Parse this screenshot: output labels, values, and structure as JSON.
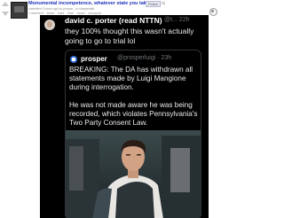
{
  "post": {
    "title": "Monumental incompetence, whatever state you take",
    "domain": "(i.redd.it)",
    "flair": "Police",
    "meta": "submitted 3 hours ago by prosper_ to r/lawyertalk",
    "actions": [
      "1 comment",
      "share",
      "save",
      "hide",
      "report",
      "crosspost"
    ]
  },
  "tweet": {
    "author_name": "david c. porter (read NTTN)",
    "author_handle": "@t... 22h",
    "text": "they 100% thought this wasn't actually going to go to trial lol"
  },
  "quoted": {
    "author_name": "prosper",
    "author_handle": "@prosperluigi · 23h",
    "para1": "BREAKING: The DA has withdrawn all statements made by Luigi Mangione during interrogation.",
    "para2": "He was not made aware he was being recorded, which violates Pennsylvania's Two Party Consent Law."
  },
  "icons": {
    "vote": "upvote-downvote-arrows",
    "x_logo": "x-logo-icon",
    "side": "award-icon"
  },
  "colors": {
    "title_link": "#2233bb",
    "tweet_bg": "#000000",
    "tweet_text": "#e7e9ea",
    "handle_gray": "#71767b"
  }
}
